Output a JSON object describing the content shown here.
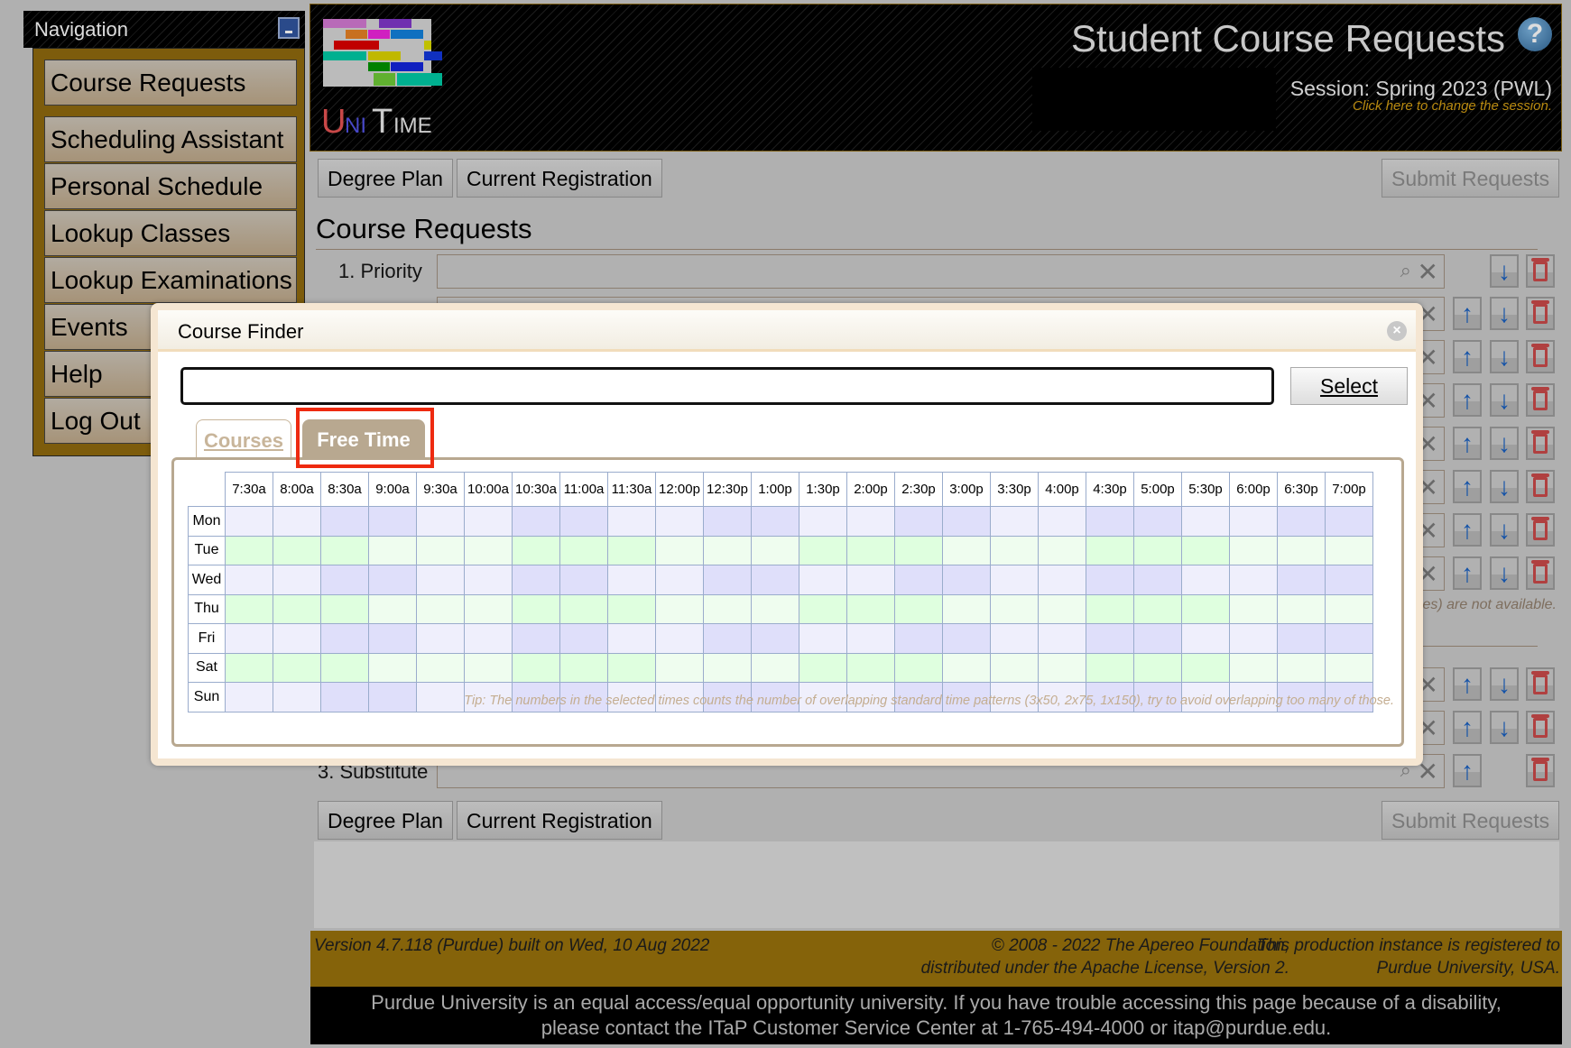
{
  "navigation": {
    "title": "Navigation",
    "items": [
      "Course Requests",
      "Scheduling Assistant",
      "Personal Schedule",
      "Lookup Classes",
      "Lookup Examinations",
      "Events",
      "Help",
      "Log Out"
    ]
  },
  "header": {
    "logo_text": "UniTime",
    "title": "Student Course Requests",
    "help_icon": "?",
    "session": "Session: Spring 2023 (PWL)",
    "session_link": "Click here to change the session."
  },
  "toolbar": {
    "degree_plan": "Degree Plan",
    "current_registration": "Current Registration",
    "submit_requests": "Submit Requests"
  },
  "course_requests": {
    "heading": "Course Requests",
    "first_row_label": "1. Priority",
    "not_available_note": "es) are not available.",
    "substitute_label": "3. Substitute"
  },
  "dialog": {
    "title": "Course Finder",
    "close_icon": "×",
    "search_value": "",
    "select_label": "Select",
    "tabs": [
      "Courses",
      "Free Time"
    ],
    "active_tab": "Free Time",
    "tip": "Tip: The numbers in the selected times counts the number of overlapping standard time patterns (3x50, 2x75, 1x150), try to avoid overlapping too many of those."
  },
  "free_time_grid": {
    "times": [
      "7:30a",
      "8:00a",
      "8:30a",
      "9:00a",
      "9:30a",
      "10:00a",
      "10:30a",
      "11:00a",
      "11:30a",
      "12:00p",
      "12:30p",
      "1:00p",
      "1:30p",
      "2:00p",
      "2:30p",
      "3:00p",
      "3:30p",
      "4:00p",
      "4:30p",
      "5:00p",
      "5:30p",
      "6:00p",
      "6:30p",
      "7:00p"
    ],
    "days": [
      "Mon",
      "Tue",
      "Wed",
      "Thu",
      "Fri",
      "Sat",
      "Sun"
    ],
    "colors": {
      "mwf_light": "#efeffc",
      "mwf_dark": "#dfdffa",
      "tth_light": "#effdef",
      "tth_dark": "#dfffdf"
    },
    "shaded_slots": {
      "Mon": [
        "8:30a",
        "9:00a",
        "10:30a",
        "11:00a",
        "12:30p",
        "1:00p",
        "2:30p",
        "3:00p",
        "4:30p",
        "5:00p",
        "6:30p",
        "7:00p"
      ],
      "Tue": [
        "7:30a",
        "8:00a",
        "8:30a",
        "10:30a",
        "11:00a",
        "11:30a",
        "1:30p",
        "2:00p",
        "2:30p",
        "4:30p",
        "5:00p",
        "5:30p"
      ],
      "Wed": [
        "8:30a",
        "9:00a",
        "10:30a",
        "11:00a",
        "12:30p",
        "1:00p",
        "2:30p",
        "3:00p",
        "4:30p",
        "5:00p",
        "6:30p",
        "7:00p"
      ],
      "Thu": [
        "7:30a",
        "8:00a",
        "8:30a",
        "10:30a",
        "11:00a",
        "11:30a",
        "1:30p",
        "2:00p",
        "2:30p",
        "4:30p",
        "5:00p",
        "5:30p"
      ],
      "Fri": [
        "8:30a",
        "9:00a",
        "10:30a",
        "11:00a",
        "12:30p",
        "1:00p",
        "2:30p",
        "3:00p",
        "4:30p",
        "5:00p",
        "6:30p",
        "7:00p"
      ],
      "Sat": [
        "7:30a",
        "8:00a",
        "8:30a",
        "10:30a",
        "11:00a",
        "11:30a",
        "1:30p",
        "2:00p",
        "2:30p",
        "4:30p",
        "5:00p",
        "5:30p"
      ],
      "Sun": [
        "8:30a",
        "9:00a",
        "10:30a",
        "11:00a",
        "12:30p",
        "1:00p",
        "2:30p",
        "3:00p",
        "4:30p",
        "5:00p",
        "6:30p",
        "7:00p"
      ]
    }
  },
  "footer": {
    "version": "Version 4.7.118 (Purdue) built on Wed, 10 Aug 2022",
    "copyright_1": "© 2008 - 2022 The Apereo Foundation,",
    "copyright_2": "distributed under the Apache License, Version 2.",
    "registered_1": "This production instance is registered to",
    "registered_2": "Purdue University, USA.",
    "notice_1": "Purdue University is an equal access/equal opportunity university. If you have trouble accessing this page because of a disability,",
    "notice_2": "please contact the ITaP Customer Service Center at 1-765-494-4000 or itap@purdue.edu."
  }
}
